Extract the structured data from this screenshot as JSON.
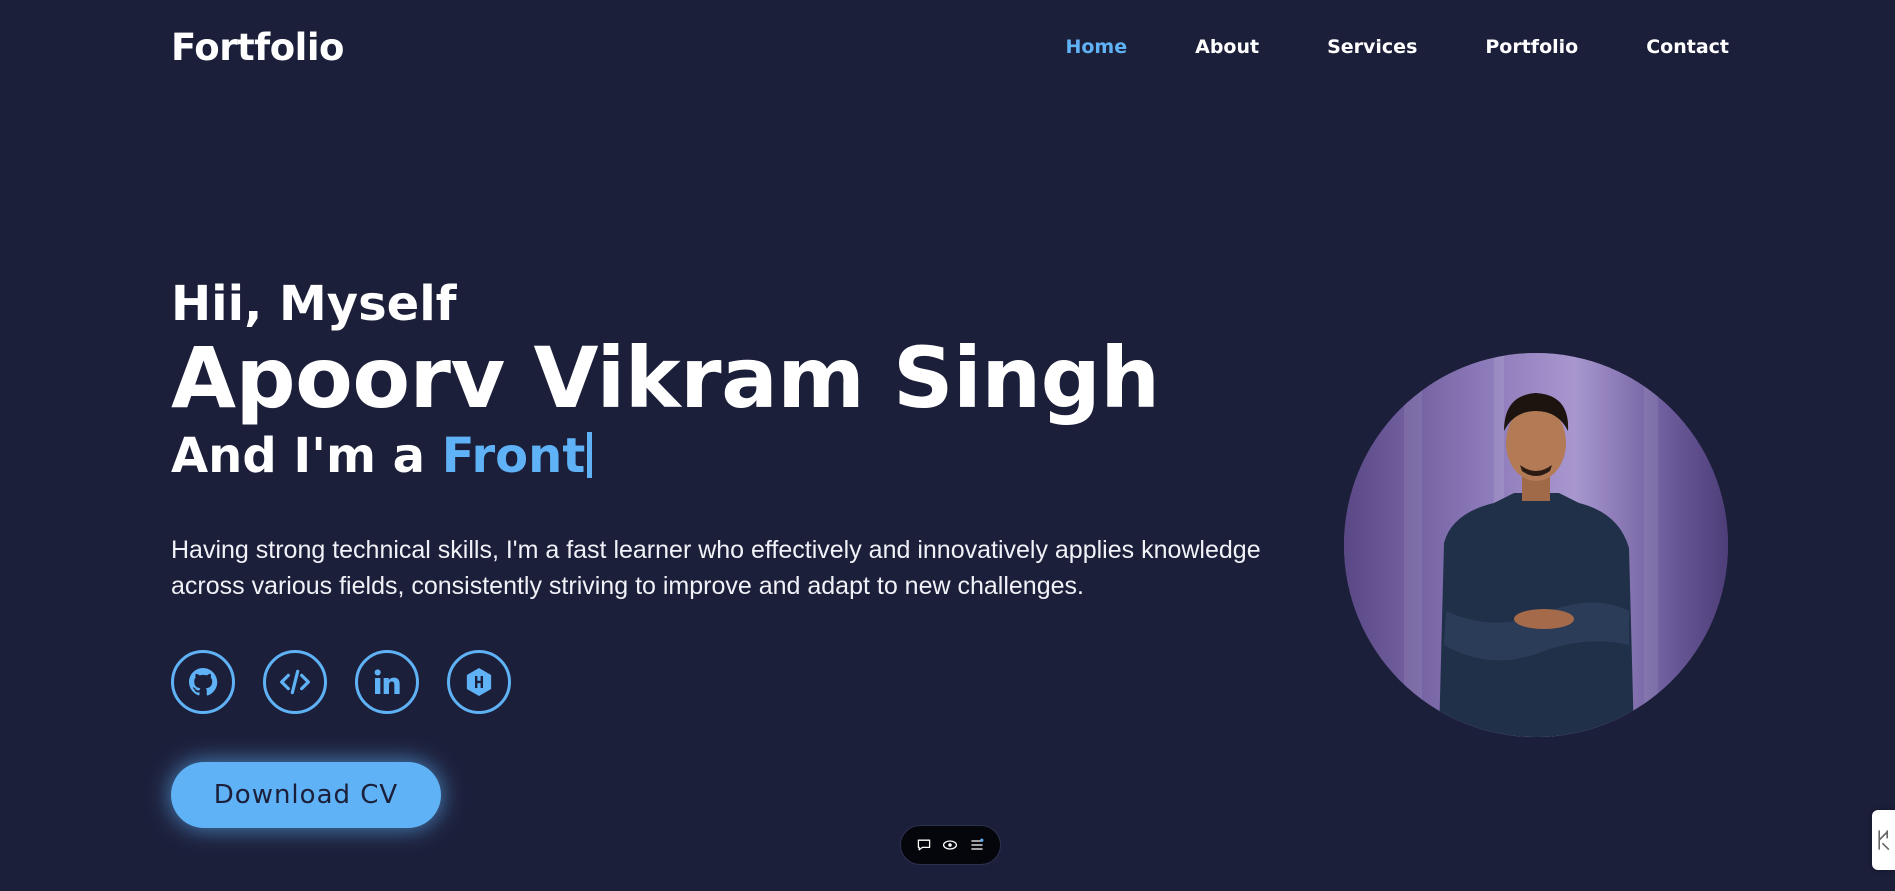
{
  "header": {
    "logo": "Fortfolio",
    "nav": [
      {
        "label": "Home",
        "active": true
      },
      {
        "label": "About",
        "active": false
      },
      {
        "label": "Services",
        "active": false
      },
      {
        "label": "Portfolio",
        "active": false
      },
      {
        "label": "Contact",
        "active": false
      }
    ]
  },
  "hero": {
    "greeting": "Hii, Myself",
    "name": "Apoorv Vikram Singh",
    "role_prefix": "And I'm a ",
    "role_typed": "Front",
    "description": "Having strong technical skills, I'm a fast learner who effectively and innovatively applies knowledge across various fields, consistently striving to improve and adapt to new challenges.",
    "socials": [
      "github-icon",
      "code-icon",
      "linkedin-icon",
      "hackerrank-icon"
    ],
    "download_label": "Download CV"
  },
  "toolbar": {
    "icons": [
      "chat-icon",
      "eye-icon",
      "menu-icon"
    ]
  },
  "colors": {
    "background": "#1c1f3a",
    "accent": "#5fb2f5",
    "text": "#ffffff"
  }
}
